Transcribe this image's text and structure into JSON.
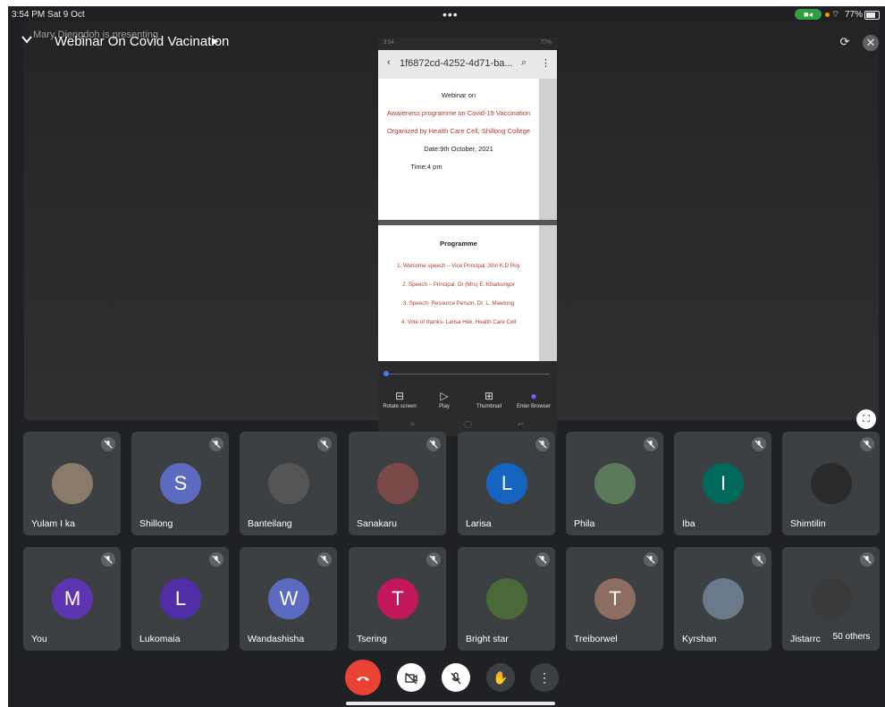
{
  "status_bar": {
    "time": "3:54 PM  Sat 9 Oct",
    "dots": "•••",
    "battery": "77%"
  },
  "header": {
    "presenting": "Mary Diengdoh is presenting",
    "meeting_title": "Webinar On Covid Vacination",
    "icons": [
      "chevron-down-icon",
      "camera-switch-icon",
      "audio-off-icon"
    ]
  },
  "shared_screen": {
    "phone_status_left": "3:54",
    "phone_status_right": "77%",
    "file_name": "1f6872cd-4252-4d71-ba...",
    "doc_page1": {
      "line1": "Webinar on",
      "line2": "Awareness programme on Covid-19 Vaccination",
      "line3": "Organized by Health Care Cell, Shillong College",
      "line4": "Date:9th October, 2021",
      "line5": "Time:4 pm"
    },
    "doc_page2": {
      "heading": "Programme",
      "items": [
        "1. Welcome speech –  Vice Principal ,Shri K.D Roy",
        "2. Speech – Principal, Dr (Mrs) E. Kharkongor",
        "3. Speech- Resource Person, Dr. L. Mawlong",
        "4. Vote of thanks- Larisa Hek, Health Care Cell"
      ]
    },
    "tools": [
      "Rotate screen",
      "Play",
      "Thumbnail",
      "Enter Browser"
    ]
  },
  "participants_row1": [
    {
      "name": "Yulam I ka",
      "initial": "",
      "color": "#8a7a6a"
    },
    {
      "name": "Shillong",
      "initial": "S",
      "color": "#5c6bc0"
    },
    {
      "name": "Banteilang",
      "initial": "",
      "color": "#555555"
    },
    {
      "name": "Sanakaru",
      "initial": "",
      "color": "#7a4a4a"
    },
    {
      "name": "Larisa",
      "initial": "L",
      "color": "#1565c0"
    },
    {
      "name": "Phila",
      "initial": "",
      "color": "#5a7a5a"
    },
    {
      "name": "Iba",
      "initial": "I",
      "color": "#00695c"
    },
    {
      "name": "Shimtilin",
      "initial": "",
      "color": "#2a2a2a"
    }
  ],
  "participants_row2": [
    {
      "name": "You",
      "initial": "M",
      "color": "#5e35b1"
    },
    {
      "name": "Lukomaia",
      "initial": "L",
      "color": "#512da8"
    },
    {
      "name": "Wandashisha",
      "initial": "W",
      "color": "#5c6bc0"
    },
    {
      "name": "Tsering",
      "initial": "T",
      "color": "#c2185b"
    },
    {
      "name": "Bright star",
      "initial": "",
      "color": "#4a6a3a"
    },
    {
      "name": "Treiborwel",
      "initial": "T",
      "color": "#8d6e63"
    },
    {
      "name": "Kyrshan",
      "initial": "",
      "color": "#6a7a8a"
    },
    {
      "name": "Jistarrc",
      "initial": "",
      "color": "#3a3a3a"
    }
  ],
  "others_label": "50 others",
  "controls": [
    "end-call",
    "camera-off",
    "mic-off",
    "raise-hand",
    "more-options"
  ]
}
